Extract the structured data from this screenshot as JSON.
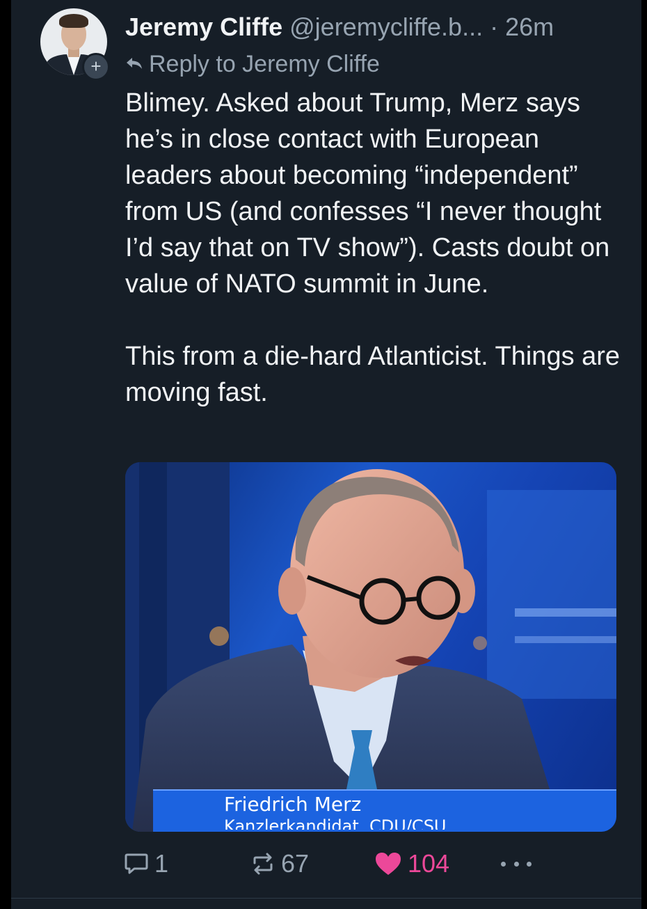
{
  "post": {
    "author_name": "Jeremy Cliffe",
    "author_handle": "@jeremycliffe.b...",
    "separator": " · ",
    "time": "26m",
    "reply_to": "Reply to Jeremy Cliffe",
    "text": "Blimey. Asked about Trump, Merz says he’s in close contact with European leaders about becoming “independent” from US (and confesses “I never thought I’d say that on TV show”). Casts doubt on value of NATO summit in June.\n\nThis from a die-hard Atlanticist. Things are moving fast.",
    "follow_badge": "+"
  },
  "media": {
    "caption_name": "Friedrich Merz",
    "caption_role": "Kanzlerkandidat, CDU/CSU"
  },
  "actions": {
    "replies": "1",
    "reposts": "67",
    "likes": "104"
  },
  "colors": {
    "background": "#161e27",
    "text": "#f1f3f5",
    "muted": "#97a4b1",
    "like": "#ec4899"
  },
  "icons": {
    "reply": "speech-bubble-icon",
    "repost": "repost-arrows-icon",
    "like": "heart-icon",
    "more": "more-dots-icon",
    "reply_to": "reply-arrow-icon"
  }
}
